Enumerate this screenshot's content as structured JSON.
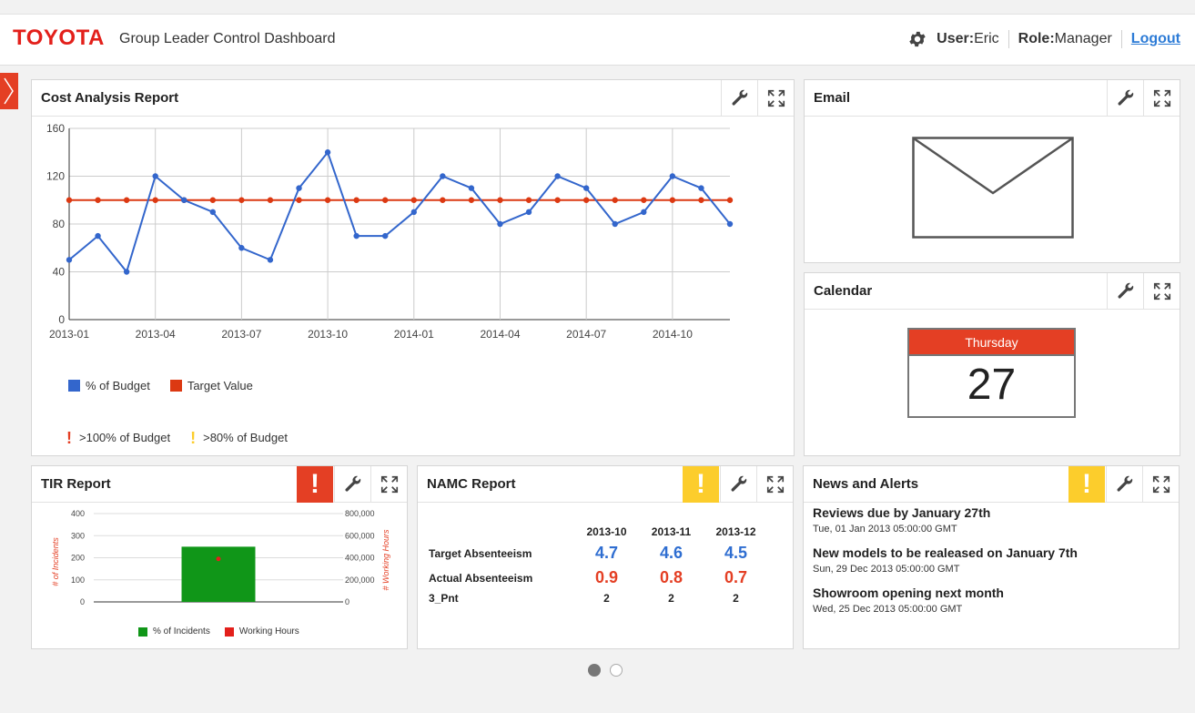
{
  "header": {
    "logo": "TOYOTA",
    "title": "Group Leader Control Dashboard",
    "user_label": "User:",
    "user_value": "Eric",
    "role_label": "Role:",
    "role_value": "Manager",
    "logout": "Logout"
  },
  "panels": {
    "cost": {
      "title": "Cost Analysis Report"
    },
    "email": {
      "title": "Email"
    },
    "calendar": {
      "title": "Calendar",
      "day": "Thursday",
      "date": "27"
    },
    "tir": {
      "title": "TIR Report",
      "alert": "!"
    },
    "namc": {
      "title": "NAMC Report",
      "alert": "!"
    },
    "news": {
      "title": "News and Alerts",
      "alert": "!"
    }
  },
  "cost_legend": {
    "series1": "% of Budget",
    "series2": "Target Value",
    "alert1": ">100% of Budget",
    "alert2": ">80% of Budget"
  },
  "tir_legend": {
    "series1": "% of Incidents",
    "series2": "Working Hours",
    "ylabel_left": "# of Incidents",
    "ylabel_right": "# Working Hours"
  },
  "namc": {
    "columns": [
      "2013-10",
      "2013-11",
      "2013-12"
    ],
    "rows": [
      {
        "label": "Target Absenteeism",
        "values": [
          "4.7",
          "4.6",
          "4.5"
        ]
      },
      {
        "label": "Actual Absenteeism",
        "values": [
          "0.9",
          "0.8",
          "0.7"
        ]
      },
      {
        "label": "3_Pnt",
        "values": [
          "2",
          "2",
          "2"
        ]
      }
    ]
  },
  "news": [
    {
      "title": "Reviews due by January 27th",
      "date": "Tue, 01 Jan 2013 05:00:00 GMT"
    },
    {
      "title": "New models to be realeased on January 7th",
      "date": "Sun, 29 Dec 2013 05:00:00 GMT"
    },
    {
      "title": "Showroom opening next month",
      "date": "Wed, 25 Dec 2013 05:00:00 GMT"
    }
  ],
  "colors": {
    "brand": "#e3201b",
    "series_blue": "#3366cc",
    "series_red": "#dc3912",
    "alert_red": "#e43f24",
    "alert_yellow": "#fccd2c",
    "bar_green": "#109618"
  },
  "chart_data": [
    {
      "type": "line",
      "x_ticks": [
        "2013-01",
        "2013-04",
        "2013-07",
        "2013-10",
        "2014-01",
        "2014-04",
        "2014-07",
        "2014-10"
      ],
      "x": [
        "2013-01",
        "2013-02",
        "2013-03",
        "2013-04",
        "2013-05",
        "2013-06",
        "2013-07",
        "2013-08",
        "2013-09",
        "2013-10",
        "2013-11",
        "2013-12",
        "2014-01",
        "2014-02",
        "2014-03",
        "2014-04",
        "2014-05",
        "2014-06",
        "2014-07",
        "2014-08",
        "2014-09",
        "2014-10",
        "2014-11",
        "2014-12"
      ],
      "series": [
        {
          "name": "% of Budget",
          "values": [
            50,
            70,
            40,
            120,
            100,
            90,
            60,
            50,
            110,
            140,
            70,
            70,
            90,
            120,
            110,
            80,
            90,
            120,
            110,
            80,
            90,
            120,
            110,
            80
          ]
        },
        {
          "name": "Target Value",
          "values": [
            100,
            100,
            100,
            100,
            100,
            100,
            100,
            100,
            100,
            100,
            100,
            100,
            100,
            100,
            100,
            100,
            100,
            100,
            100,
            100,
            100,
            100,
            100,
            100
          ]
        }
      ],
      "ylim": [
        0,
        160
      ],
      "y_ticks": [
        0,
        40,
        80,
        120,
        160
      ],
      "grid": true,
      "legend": "bottom-left"
    },
    {
      "type": "bar",
      "categories": [
        ""
      ],
      "series": [
        {
          "name": "% of Incidents",
          "values": [
            250
          ],
          "axis": "left"
        },
        {
          "name": "Working Hours",
          "values": [
            390000
          ],
          "axis": "right",
          "mark": "point"
        }
      ],
      "ylabel": "# of Incidents",
      "y2label": "# Working Hours",
      "ylim": [
        0,
        400
      ],
      "y_ticks": [
        0,
        100,
        200,
        300,
        400
      ],
      "y2lim": [
        0,
        800000
      ],
      "y2_ticks": [
        "0",
        "200,000",
        "400,000",
        "600,000",
        "800,000"
      ],
      "grid": true,
      "legend": "bottom"
    }
  ]
}
